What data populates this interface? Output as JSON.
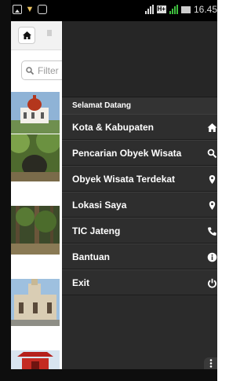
{
  "status_bar": {
    "time": "16.45"
  },
  "app": {
    "search_placeholder": "Filter"
  },
  "drawer": {
    "heading": "Selamat Datang",
    "items": [
      {
        "label": "Kota & Kabupaten",
        "icon": "home-icon"
      },
      {
        "label": "Pencarian Obyek Wisata",
        "icon": "search-icon"
      },
      {
        "label": "Obyek Wisata Terdekat",
        "icon": "map-pin-icon"
      },
      {
        "label": "Lokasi Saya",
        "icon": "location-pin-icon"
      },
      {
        "label": "TIC Jateng",
        "icon": "phone-icon"
      },
      {
        "label": "Bantuan",
        "icon": "info-icon"
      },
      {
        "label": "Exit",
        "icon": "power-icon"
      }
    ]
  },
  "colors": {
    "drawer_bg": "#2b2b2b",
    "item_bg": "#2e2e2e",
    "text": "#ffffff"
  }
}
